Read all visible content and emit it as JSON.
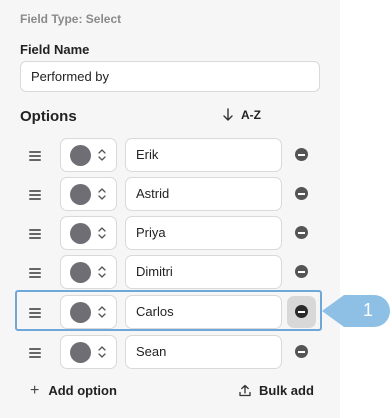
{
  "header": {
    "field_type": "Field Type: Select"
  },
  "field_name": {
    "label": "Field Name",
    "value": "Performed by"
  },
  "options": {
    "title": "Options",
    "sort_label": "A-Z",
    "items": [
      {
        "label": "Erik",
        "color": "#6e6e74"
      },
      {
        "label": "Astrid",
        "color": "#6e6e74"
      },
      {
        "label": "Priya",
        "color": "#6e6e74"
      },
      {
        "label": "Dimitri",
        "color": "#6e6e74"
      },
      {
        "label": "Carlos",
        "color": "#6e6e74"
      },
      {
        "label": "Sean",
        "color": "#6e6e74"
      }
    ]
  },
  "footer": {
    "add_option": "Add option",
    "bulk_add": "Bulk add"
  },
  "callout": {
    "number": "1",
    "color": "#8ec0e6"
  }
}
